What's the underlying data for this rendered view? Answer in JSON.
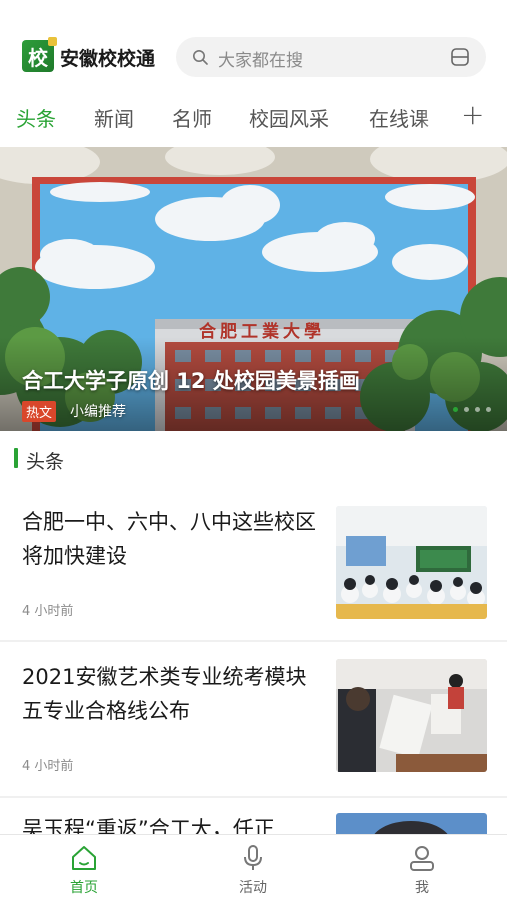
{
  "header": {
    "logo_glyph": "校",
    "app_title": "安徽校校通",
    "search_placeholder": "大家都在搜",
    "accent_color": "#2aa335"
  },
  "tabs": [
    {
      "label": "头条",
      "active": true
    },
    {
      "label": "新闻",
      "active": false
    },
    {
      "label": "名师",
      "active": false
    },
    {
      "label": "校园风采",
      "active": false
    },
    {
      "label": "在线课",
      "active": false
    }
  ],
  "tabs_more": "+",
  "banner": {
    "title": "合工大学子原创 12 处校园美景插画",
    "badge": "热文",
    "tag": "小编推荐",
    "building_sign": "合肥工業大學",
    "carousel_count": 4,
    "carousel_active": 0
  },
  "section": {
    "title": "头条"
  },
  "news": [
    {
      "title": "合肥一中、六中、八中这些校区将加快建设",
      "time": "4 小时前",
      "thumb": "classroom-photo"
    },
    {
      "title": "2021安徽艺术类专业统考模块五专业合格线公布",
      "time": "4 小时前",
      "thumb": "art-exam-photo"
    },
    {
      "title": "吴玉程“重返”合工大，任正",
      "time": "",
      "thumb": "portrait-photo"
    }
  ],
  "bottom_nav": [
    {
      "label": "首页",
      "icon": "home-icon",
      "active": true
    },
    {
      "label": "活动",
      "icon": "microphone-icon",
      "active": false
    },
    {
      "label": "我",
      "icon": "user-icon",
      "active": false
    }
  ]
}
